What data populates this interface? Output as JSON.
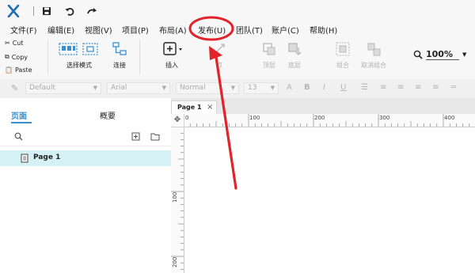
{
  "quick_access": {
    "logo_icon": "axure-x-logo",
    "save_icon": "save-icon",
    "undo_icon": "undo-icon",
    "redo_icon": "redo-icon"
  },
  "menu": {
    "items": [
      "文件(F)",
      "编辑(E)",
      "视图(V)",
      "项目(P)",
      "布局(A)",
      "发布(U)",
      "团队(T)",
      "账户(C)",
      "帮助(H)"
    ]
  },
  "ribbon": {
    "cut": "Cut",
    "copy": "Copy",
    "paste": "Paste",
    "select_mode": "选择模式",
    "connect": "连接",
    "insert": "插入",
    "point": "点",
    "top": "顶层",
    "bottom": "底层",
    "group": "组合",
    "ungroup": "取消组合",
    "zoom": "100%"
  },
  "format_bar": {
    "style": "Default",
    "font": "Arial",
    "weight": "Normal",
    "size": "13"
  },
  "left_panel": {
    "tab_pages": "页面",
    "tab_outline": "概要",
    "page_item": "Page 1"
  },
  "canvas": {
    "doc_tab": "Page 1",
    "close_glyph": "×",
    "hruler_labels": [
      "0",
      "100",
      "200",
      "300",
      "400"
    ],
    "vruler_labels": [
      "100",
      "200"
    ]
  },
  "colors": {
    "accent": "#3a8fcf",
    "annotation": "#e0242a",
    "page_selected": "#d6f1f5",
    "logo": "#1f6fb5"
  }
}
